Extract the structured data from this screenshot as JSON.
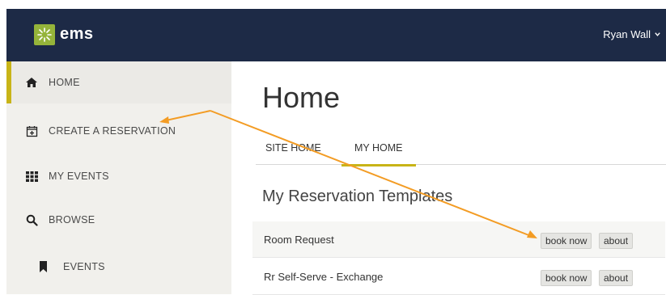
{
  "header": {
    "logo_text": "ems",
    "user_name": "Ryan Wall",
    "bar_color": "#1d2a46",
    "logo_color": "#95b43a"
  },
  "sidebar": {
    "accent_color": "#c8b417",
    "items": [
      {
        "label": "HOME",
        "icon": "home-icon",
        "active": true
      },
      {
        "label": "CREATE A RESERVATION",
        "icon": "calendar-plus-icon"
      },
      {
        "label": "MY EVENTS",
        "icon": "grid-icon"
      },
      {
        "label": "BROWSE",
        "icon": "search-icon"
      },
      {
        "label": "EVENTS",
        "icon": "bookmark-icon",
        "sub": true
      }
    ]
  },
  "main": {
    "title": "Home",
    "tabs": [
      {
        "label": "SITE HOME"
      },
      {
        "label": "MY HOME",
        "active": true
      }
    ],
    "section_title": "My Reservation Templates",
    "templates": [
      {
        "name": "Room Request",
        "book_label": "book now",
        "about_label": "about"
      },
      {
        "name": "Rr Self-Serve - Exchange",
        "book_label": "book now",
        "about_label": "about"
      }
    ]
  },
  "annotation": {
    "arrow_color": "#f39c24"
  }
}
